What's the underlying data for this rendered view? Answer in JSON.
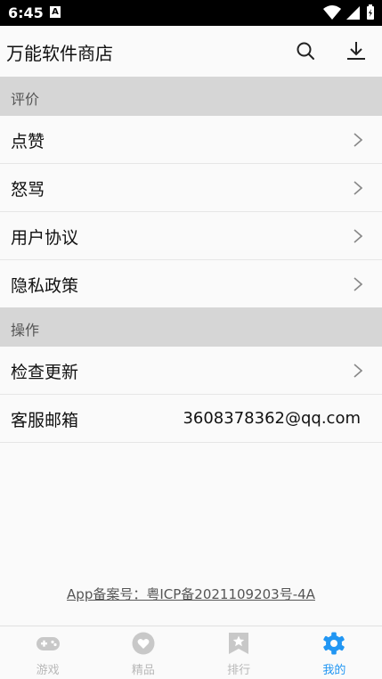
{
  "status_bar": {
    "time": "6:45",
    "notification_icon": "A"
  },
  "app_bar": {
    "title": "万能软件商店",
    "icons": [
      "search-icon",
      "download-icon"
    ]
  },
  "sections": [
    {
      "header": "评价",
      "items": [
        {
          "label": "点赞"
        },
        {
          "label": "怒骂"
        },
        {
          "label": "用户协议"
        },
        {
          "label": "隐私政策"
        }
      ]
    },
    {
      "header": "操作",
      "items": [
        {
          "label": "检查更新"
        },
        {
          "label": "客服邮箱",
          "value": "3608378362@qq.com"
        }
      ]
    }
  ],
  "footer": {
    "icp": "App备案号：粤ICP备2021109203号-4A"
  },
  "bottom_nav": {
    "items": [
      {
        "label": "游戏",
        "icon": "gamepad-icon"
      },
      {
        "label": "精品",
        "icon": "heart-icon"
      },
      {
        "label": "排行",
        "icon": "ranking-icon"
      },
      {
        "label": "我的",
        "icon": "gear-icon",
        "active": true
      }
    ]
  },
  "colors": {
    "accent": "#2196f3",
    "section_bg": "#d6d6d6",
    "nav_inactive": "#b8b8b8"
  }
}
